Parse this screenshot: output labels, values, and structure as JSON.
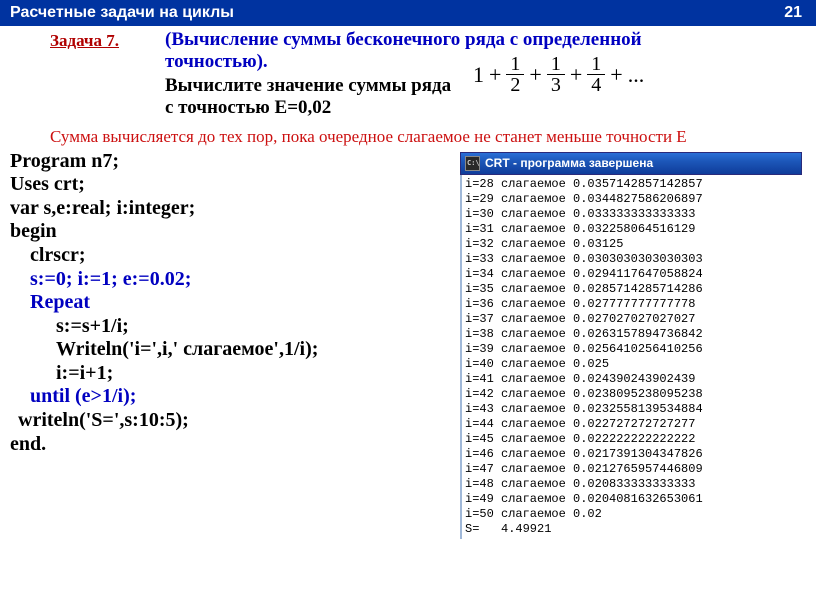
{
  "header": {
    "title": "Расчетные задачи на циклы",
    "number": "21"
  },
  "task_label": "Задача 7.",
  "problem": {
    "title1": "(Вычисление суммы бесконечного ряда с определенной",
    "title2": "точностью).",
    "desc1": "Вычислите значение суммы ряда",
    "desc2": "с точностью Е=0,02"
  },
  "formula": {
    "one": "1",
    "plus": "+",
    "n2": "1",
    "d2": "2",
    "n3": "1",
    "d3": "3",
    "n4": "1",
    "d4": "4",
    "dots": "..."
  },
  "note": "Сумма вычисляется до тех пор, пока очередное слагаемое не станет меньше точности Е",
  "code": {
    "l1": "Program n7;",
    "l2": "Uses crt;",
    "l3": "var  s,e:real;   i:integer;",
    "l4": "begin",
    "l5": "clrscr;",
    "l6": "s:=0;  i:=1;  e:=0.02;",
    "l7": "Repeat",
    "l8": "s:=s+1/i;",
    "l9": "Writeln('i=',i,' слагаемое',1/i);",
    "l10": "i:=i+1;",
    "l11": "until (e>1/i);",
    "l12": "writeln('S=',s:10:5);",
    "l13": "end."
  },
  "crt": {
    "title": "CRT - программа завершена",
    "lines": [
      "i=28 слагаемое 0.0357142857142857",
      "i=29 слагаемое 0.0344827586206897",
      "i=30 слагаемое 0.033333333333333",
      "i=31 слагаемое 0.032258064516129",
      "i=32 слагаемое 0.03125",
      "i=33 слагаемое 0.0303030303030303",
      "i=34 слагаемое 0.0294117647058824",
      "i=35 слагаемое 0.0285714285714286",
      "i=36 слагаемое 0.027777777777778",
      "i=37 слагаемое 0.027027027027027",
      "i=38 слагаемое 0.0263157894736842",
      "i=39 слагаемое 0.0256410256410256",
      "i=40 слагаемое 0.025",
      "i=41 слагаемое 0.024390243902439",
      "i=42 слагаемое 0.0238095238095238",
      "i=43 слагаемое 0.0232558139534884",
      "i=44 слагаемое 0.022727272727277",
      "i=45 слагаемое 0.022222222222222",
      "i=46 слагаемое 0.0217391304347826",
      "i=47 слагаемое 0.0212765957446809",
      "i=48 слагаемое 0.020833333333333",
      "i=49 слагаемое 0.0204081632653061",
      "i=50 слагаемое 0.02",
      "S=   4.49921"
    ]
  }
}
